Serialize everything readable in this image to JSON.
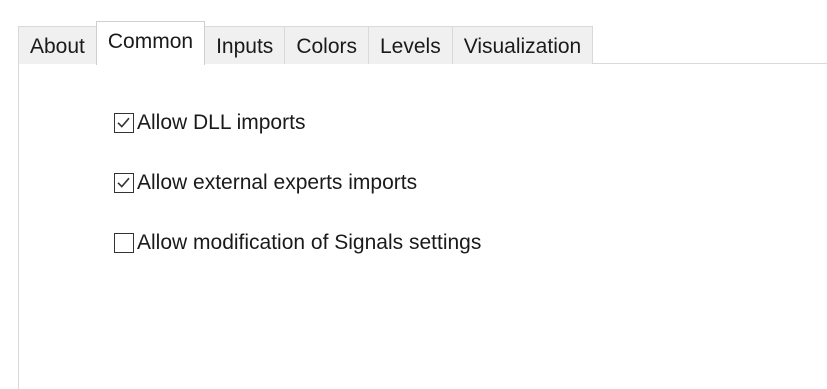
{
  "tabs": [
    {
      "label": "About",
      "active": false
    },
    {
      "label": "Common",
      "active": true
    },
    {
      "label": "Inputs",
      "active": false
    },
    {
      "label": "Colors",
      "active": false
    },
    {
      "label": "Levels",
      "active": false
    },
    {
      "label": "Visualization",
      "active": false
    }
  ],
  "common": {
    "options": [
      {
        "label": "Allow DLL imports",
        "checked": true
      },
      {
        "label": "Allow external experts imports",
        "checked": true
      },
      {
        "label": "Allow modification of Signals settings",
        "checked": false
      }
    ]
  },
  "colors": {
    "tab_inactive_bg": "#f0f0f0",
    "tab_active_bg": "#ffffff",
    "border": "#d9d9d9",
    "check_mark": "#333333"
  }
}
